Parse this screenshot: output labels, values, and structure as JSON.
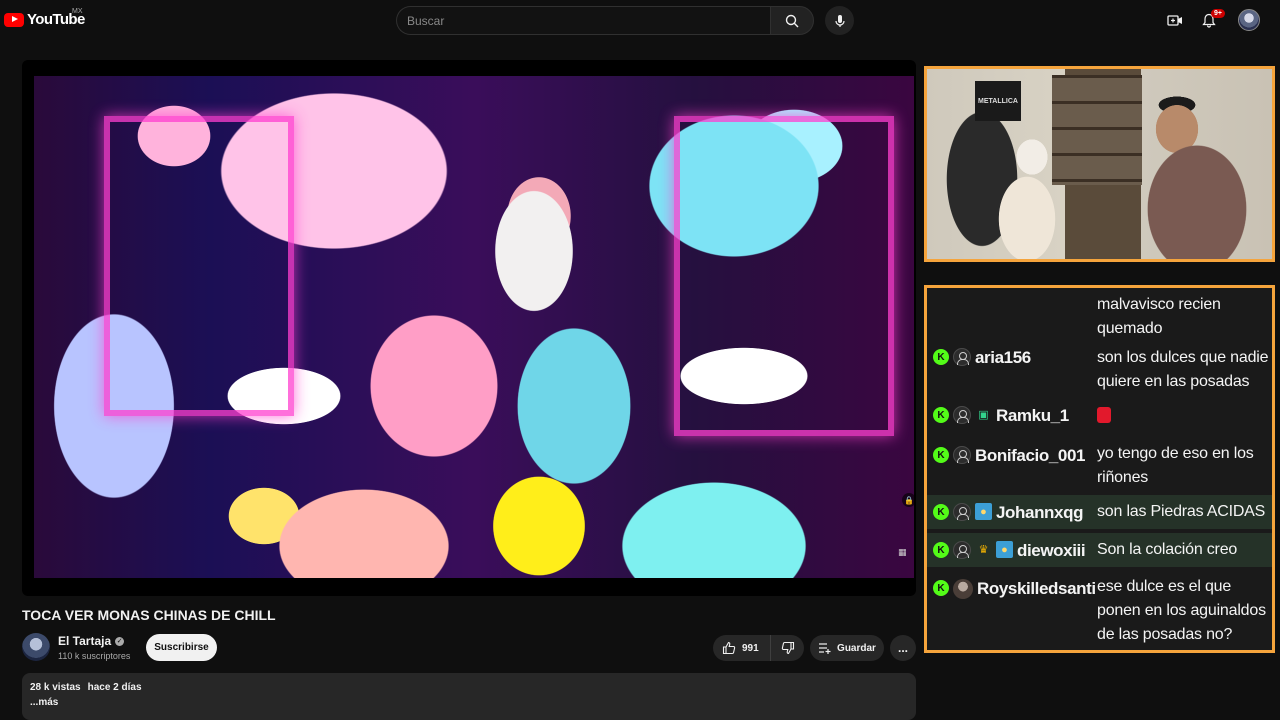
{
  "header": {
    "logo_text": "YouTube",
    "country": "MX",
    "search_placeholder": "Buscar",
    "notifications_badge": "9+"
  },
  "video": {
    "title": "TOCA VER MONAS CHINAS DE CHILL",
    "channel_name": "El Tartaja",
    "subscribers": "110 k suscriptores",
    "subscribe_label": "Suscribirse",
    "likes": "991",
    "save_label": "Guardar",
    "more_label": "...",
    "views": "28 k vistas",
    "uploaded": "hace 2 días",
    "description_more": "...más"
  },
  "webcam": {
    "poster_text": "METALLICA"
  },
  "chat": {
    "messages": [
      {
        "user": "",
        "text": "malvavisco recien quemado"
      },
      {
        "user": "aria156",
        "text": "son los dulces que nadie quiere en las posadas"
      },
      {
        "user": "Ramku_1",
        "text": ""
      },
      {
        "user": "Bonifacio_001",
        "text": "yo tengo de eso en los riñones"
      },
      {
        "user": "Johannxqg",
        "text": "son las Piedras ACIDAS"
      },
      {
        "user": "diewoxiii",
        "text": "Son la colación creo"
      },
      {
        "user": "Royskilledsanti",
        "text": "ese dulce es el que ponen en los aguinaldos de las posadas no?"
      }
    ]
  },
  "colors": {
    "accent_border": "#f5a43c",
    "kick_green": "#53fc18",
    "youtube_red": "#ff0000"
  }
}
